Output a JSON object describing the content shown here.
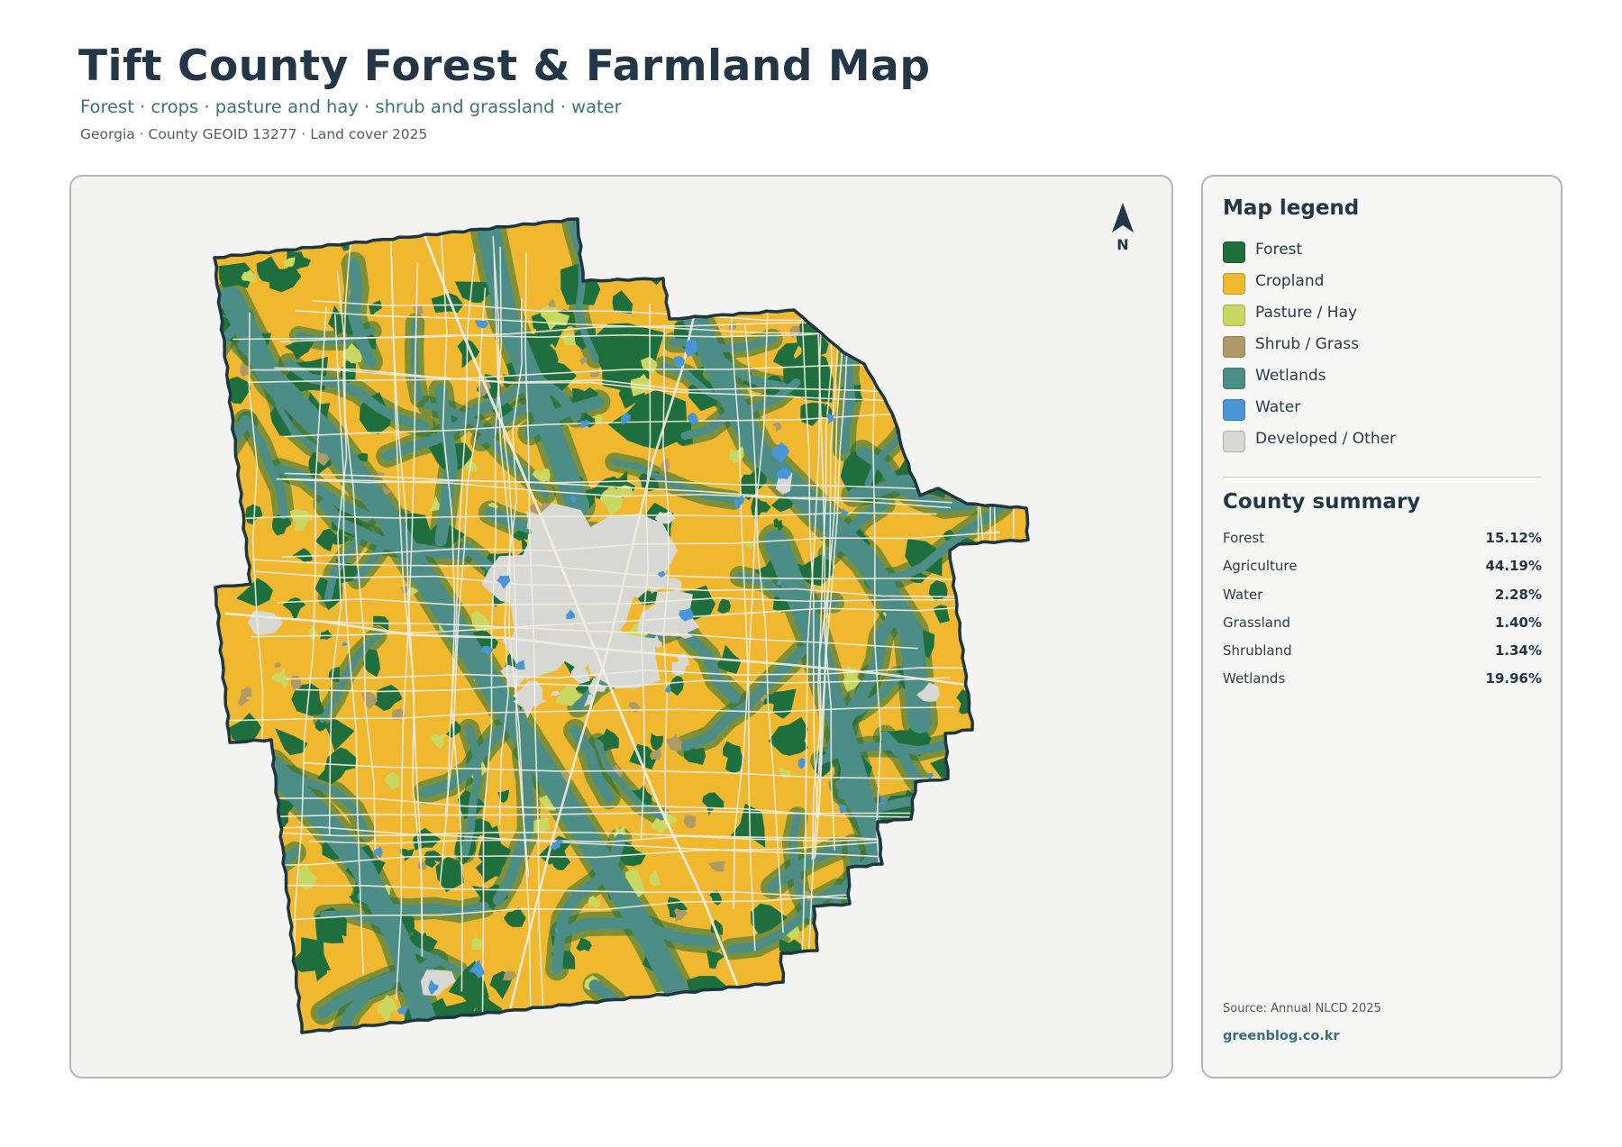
{
  "header": {
    "title": "Tift County Forest & Farmland Map",
    "subtitle": "Forest · crops · pasture and hay · shrub and grassland · water",
    "meta": "Georgia · County GEOID 13277 · Land cover 2025"
  },
  "map": {
    "north_label": "N",
    "colors": {
      "forest": "#1f6e3e",
      "cropland": "#f0b82f",
      "pasture": "#c8d860",
      "shrub": "#ad9a66",
      "wetlands": "#4c8d88",
      "water": "#4a95d6",
      "developed": "#d7d8d4",
      "road": "#f1ede1",
      "outline": "#1e3640"
    }
  },
  "legend": {
    "title": "Map legend",
    "items": [
      {
        "label": "Forest",
        "color": "#1f6e3e"
      },
      {
        "label": "Cropland",
        "color": "#f0b82f"
      },
      {
        "label": "Pasture / Hay",
        "color": "#c8d860"
      },
      {
        "label": "Shrub / Grass",
        "color": "#ad9a66"
      },
      {
        "label": "Wetlands",
        "color": "#4c8d88"
      },
      {
        "label": "Water",
        "color": "#4a95d6"
      },
      {
        "label": "Developed / Other",
        "color": "#d7d8d4"
      }
    ]
  },
  "summary": {
    "title": "County summary",
    "rows": [
      {
        "label": "Forest",
        "value": "15.12%"
      },
      {
        "label": "Agriculture",
        "value": "44.19%"
      },
      {
        "label": "Water",
        "value": "2.28%"
      },
      {
        "label": "Grassland",
        "value": "1.40%"
      },
      {
        "label": "Shrubland",
        "value": "1.34%"
      },
      {
        "label": "Wetlands",
        "value": "19.96%"
      }
    ]
  },
  "footer": {
    "source": "Source: Annual NLCD 2025",
    "brand": "greenblog.co.kr"
  }
}
